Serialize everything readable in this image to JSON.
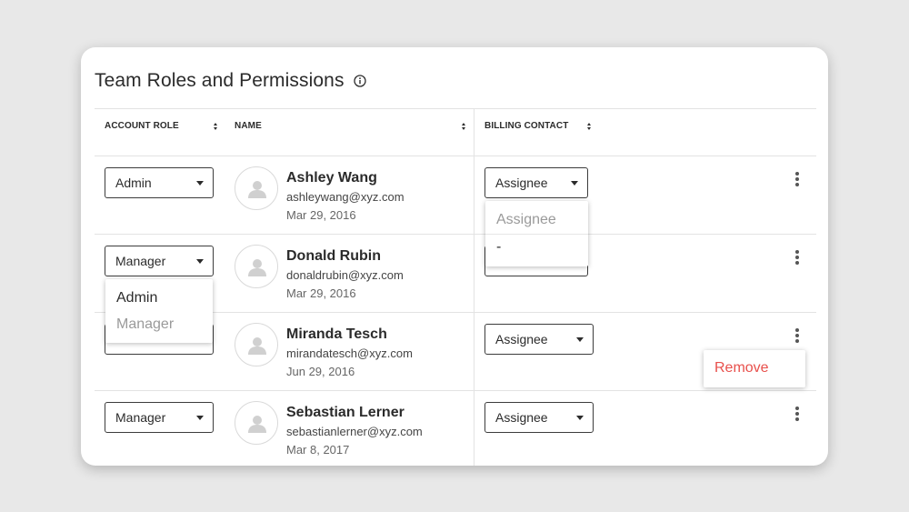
{
  "page": {
    "title": "Team Roles and Permissions"
  },
  "columns": {
    "account_role": "ACCOUNT ROLE",
    "name": "NAME",
    "billing_contact": "BILLING CONTACT"
  },
  "rows": [
    {
      "role": "Admin",
      "name": "Ashley Wang",
      "email": "ashleywang@xyz.com",
      "date": "Mar 29, 2016",
      "billing": "Assignee"
    },
    {
      "role": "Manager",
      "name": "Donald Rubin",
      "email": "donaldrubin@xyz.com",
      "date": "Mar 29, 2016",
      "billing": ""
    },
    {
      "role": "",
      "name": "Miranda Tesch",
      "email": "mirandatesch@xyz.com",
      "date": "Jun 29, 2016",
      "billing": "Assignee"
    },
    {
      "role": "Manager",
      "name": "Sebastian Lerner",
      "email": "sebastianlerner@xyz.com",
      "date": "Mar 8, 2017",
      "billing": "Assignee"
    }
  ],
  "billing_dropdown": {
    "options": [
      "Assignee",
      "-"
    ]
  },
  "role_dropdown": {
    "options": [
      "Admin",
      "Manager"
    ]
  },
  "row_menu": {
    "remove_label": "Remove"
  },
  "colors": {
    "remove": "#e8504c",
    "muted_option": "#9a9a9a"
  },
  "icons": {
    "info": "info-circle-icon",
    "sort": "sort-icon",
    "avatar": "user-silhouette-icon",
    "more": "kebab-menu-icon",
    "caret": "caret-down-icon"
  }
}
